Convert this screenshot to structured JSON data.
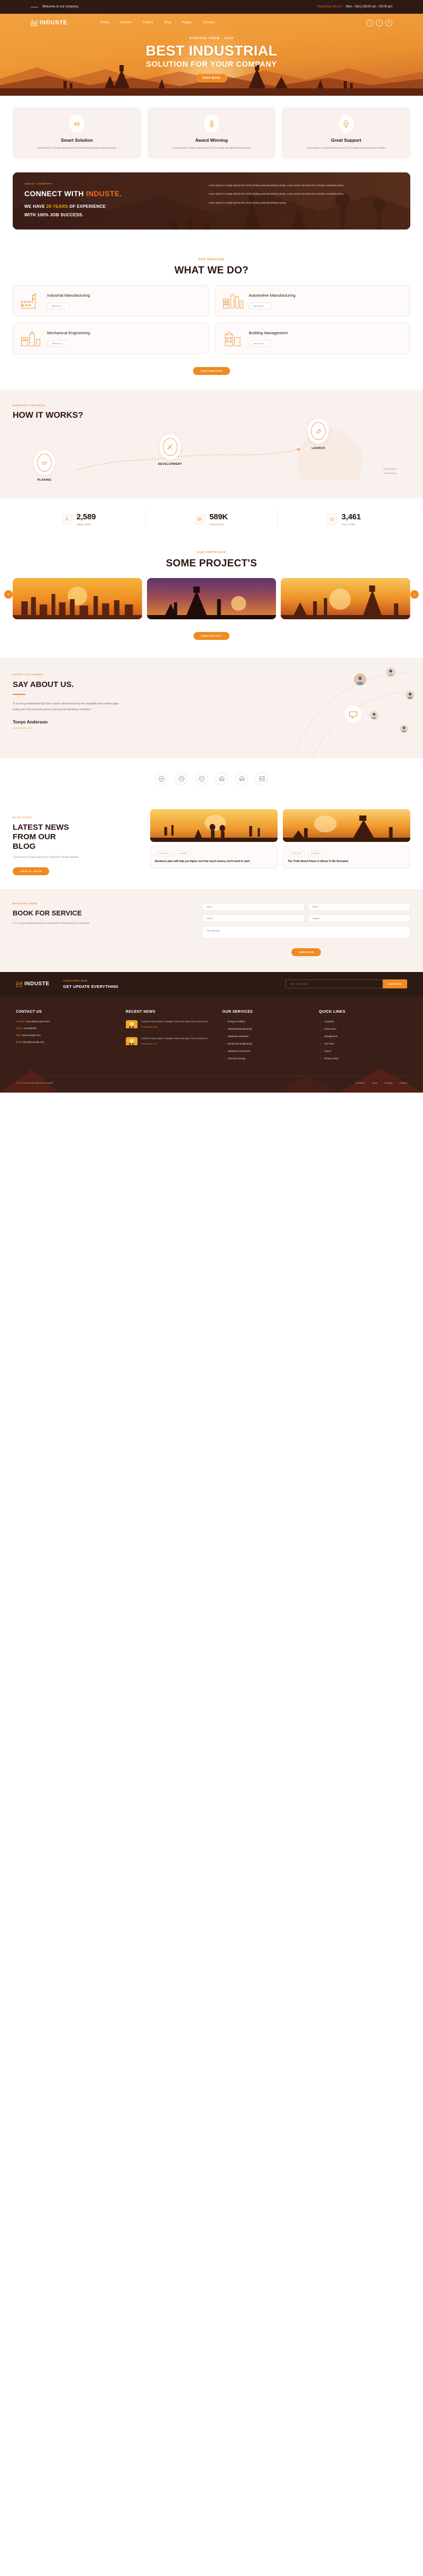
{
  "brand": {
    "name": "INDUSTE",
    "accent": "#ef8b22",
    "dark": "#2d1a15",
    "deep_brown": "#3a1f19"
  },
  "topbar": {
    "welcome": "Welcome to our company.",
    "hours_label": "Opening Hours:",
    "hours_value": "Mon - Sat || 08:00 am - 05:00 pm"
  },
  "nav": {
    "items": [
      "Home",
      "Service",
      "Project",
      "Blog",
      "Pages",
      "Contact"
    ],
    "social": [
      {
        "name": "facebook-icon",
        "glyph": "f"
      },
      {
        "name": "twitter-icon",
        "glyph": "t"
      },
      {
        "name": "linkedin-icon",
        "glyph": "in"
      }
    ]
  },
  "hero": {
    "eyebrow": "STARTED FROM - 1998",
    "title_line1": "BEST INDUSTRIAL",
    "title_line2": "SOLUTION FOR YOUR COMPANY",
    "button": "READ MORE"
  },
  "features": [
    {
      "icon": "brain-gear-icon",
      "title": "Smart Solution",
      "text": "Lorem ipsum is simply dummy text of the printing and typesetting industry."
    },
    {
      "icon": "award-medal-icon",
      "title": "Award Winning",
      "text": "Lorem ipsum is simply dummy text of the printing and typesetting industry."
    },
    {
      "icon": "lightbulb-gear-icon",
      "title": "Great Support",
      "text": "Lorem ipsum is simply dummy text of the printing and typesetting industry."
    }
  ],
  "about": {
    "eyebrow": "ABOUT COMPANY",
    "heading_plain": "CONNECT WITH ",
    "heading_highlight": "INDUSTE.",
    "sub_a": "WE HAVE ",
    "sub_years": "28 YEARS",
    "sub_b": " OF EXPERIENCE",
    "sub_c": "WITH 100% JOB SUCCESS.",
    "paragraphs": [
      "Lorem ipsum is simply dummy text of the printing and typesetting industry. Lorem ipsum has been the industry's standard printer.",
      "Lorem ipsum is simply dummy text of the printing and typesetting industry. Lorem ipsum has been the industry's standard printer.",
      "Lorem ipsum is simply dummy text of the printing and typesetting industry."
    ]
  },
  "services": {
    "eyebrow": "OUR SERVICES",
    "title": "WHAT WE DO?",
    "details_label": "DETAILS →",
    "items": [
      {
        "icon": "factory-icon",
        "title": "Industrial Manufacturing"
      },
      {
        "icon": "refinery-icon",
        "title": "Automotive Manufacturing"
      },
      {
        "icon": "plant-icon",
        "title": "Mechanical Engineering"
      },
      {
        "icon": "building-icon",
        "title": "Building Management"
      }
    ],
    "more_button": "VIEW SERVICES"
  },
  "how": {
    "eyebrow": "WORKING PROCESS",
    "title": "HOW IT WORKS?",
    "steps": [
      {
        "icon": "handshake-icon",
        "label": "PLANING"
      },
      {
        "icon": "tools-icon",
        "label": "DEVELOPMENT"
      },
      {
        "icon": "rocket-icon",
        "label": "LAUNCH"
      }
    ],
    "note_line1": "Market Analysis",
    "note_line2": "Smart Thinking"
  },
  "counters": [
    {
      "icon": "user-icon",
      "value": "2,589",
      "label": "Happy Clients"
    },
    {
      "icon": "gear-icon",
      "value": "589K",
      "label": "Projects Done"
    },
    {
      "icon": "coffee-icon",
      "value": "3,461",
      "label": "Cup of coffee"
    }
  ],
  "portfolio": {
    "eyebrow": "OUR PORTFOLIO",
    "title": "SOME PROJECT'S",
    "button": "VIEW PROJECT",
    "prev_icon": "chevron-left-icon",
    "next_icon": "chevron-right-icon",
    "slides": [
      {
        "name": "refinery-sunset"
      },
      {
        "name": "oil-pump-dusk"
      },
      {
        "name": "derrick-sunrise"
      }
    ]
  },
  "testimonial": {
    "eyebrow": "HAPPY CUSTOMER",
    "title": "SAY ABOUT US.",
    "quote": "\"It is a long established fact that a reader will distracted by the reasdable and content page looking at it and ayout the point is that normal distribution of letters.\"",
    "name": "Tonye Anderson",
    "role": "CUSTOMER, USA"
  },
  "brands": [
    {
      "name": "brand-logo-1"
    },
    {
      "name": "brand-logo-2"
    },
    {
      "name": "brand-logo-3"
    },
    {
      "name": "brand-logo-4"
    },
    {
      "name": "brand-logo-5"
    },
    {
      "name": "brand-logo-6"
    }
  ],
  "blog": {
    "eyebrow": "BLOG POST",
    "title_l1": "LATEST NEWS",
    "title_l2": "FROM OUR",
    "title_l3": "BLOG",
    "desc": "Lorem Ipsum is simply dummy text of laen the industry standard.",
    "button": "VIEW ALL BLOG",
    "posts": [
      {
        "image": "workers-sunset",
        "chips": [
          "03 FEB, 2021",
          "BY ADMIN"
        ],
        "title": "Business plan will help you figure out how much money you'll need to start."
      },
      {
        "image": "oil-pump-sunset",
        "chips": [
          "03 FEB, 2021",
          "BY ADMIN"
        ],
        "title": "The Truth About Power Is About To Be Revealed."
      }
    ]
  },
  "booking": {
    "eyebrow": "BOOKING NOW",
    "title": "BOOK FOR SERVICE",
    "desc": "It is a long established fact that a reader will be distracted by the reasdable.",
    "fields": {
      "name_placeholder": "Name *",
      "email_placeholder": "Email *",
      "phone_placeholder": "Phone *",
      "subject_placeholder": "Subject *",
      "message_placeholder": "Your Message"
    },
    "submit": "SEND NOW"
  },
  "subscribe": {
    "eyebrow": "SUBSCRIBE NOW",
    "heading": "GET UPDATE EVERYTHING",
    "input_placeholder": "Enter Your Email",
    "button": "SUBSCRIBE"
  },
  "footer": {
    "contact": {
      "heading": "CONTACT US",
      "rows": [
        {
          "label": "Location:",
          "value": "Your address goes here."
        },
        {
          "label": "Phone:",
          "value": "0123456789"
        },
        {
          "label": "Web:",
          "value": "www.example.com"
        },
        {
          "label": "Email:",
          "value": "demo@example.com"
        }
      ]
    },
    "recent": {
      "heading": "RECENT NEWS",
      "items": [
        {
          "title": "LOREM IPSUM SIMPLY DUMME PRINTING AND TYPE INDUSTRY.",
          "date": "03 February, 2021"
        },
        {
          "title": "LOREM IPSUM SIMPLY DUMME PRINTING AND TYPE INDUSTRY.",
          "date": "03 February, 2021"
        }
      ]
    },
    "services": {
      "heading": "OUR SERVICES",
      "items": [
        "Energy & Utilities",
        "Industrial Manufacturing",
        "Industrial Automation",
        "Mechanical Engineering",
        "Industrial Construction",
        "Oil & Gas Energy"
      ]
    },
    "quick": {
      "heading": "QUICK LINKS",
      "items": [
        "Company",
        "Help Center",
        "Management",
        "Our Team",
        "Career",
        "Privacy Policy"
      ]
    },
    "copyright_a": "© 2021 Induste",
    "copyright_b": " Made with ♥ by ThemeIM",
    "links": [
      "Disclaimer",
      "Terms",
      "Company",
      "Linkedin"
    ]
  }
}
